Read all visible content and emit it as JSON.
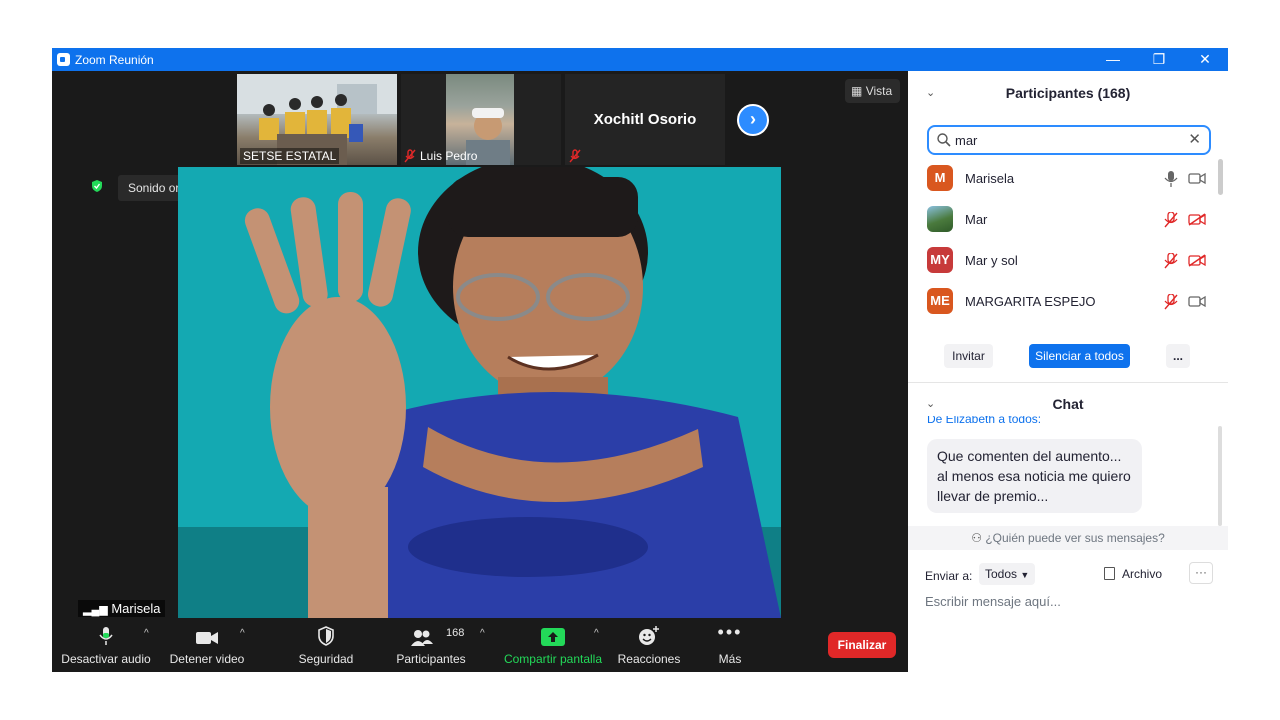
{
  "window": {
    "title": "Zoom Reunión",
    "controls": [
      "—",
      "❐",
      "✕"
    ]
  },
  "stage": {
    "thumbnails": [
      {
        "label": "SETSE ESTATAL"
      },
      {
        "label": "Luis Pedro",
        "muted": true
      },
      {
        "label": "Xochitl Osorio",
        "muted": true
      }
    ],
    "view_button": "Vista",
    "original_sound": "Sonido original: desactivado",
    "speaker_name": "Marisela"
  },
  "toolbar": {
    "audio": "Desactivar audio",
    "video": "Detener video",
    "security": "Seguridad",
    "participants": "Participantes",
    "participants_count": "168",
    "share": "Compartir pantalla",
    "reactions": "Reacciones",
    "more": "Más",
    "end": "Finalizar"
  },
  "panel": {
    "participants_title": "Participantes (168)",
    "search_value": "mar",
    "participants": [
      {
        "initials": "M",
        "name": "Marisela",
        "color": "#d9571f",
        "mic": "on",
        "cam": "on"
      },
      {
        "initials": "",
        "name": "Mar",
        "color": "#4a7a3d",
        "mic": "muted",
        "cam": "off"
      },
      {
        "initials": "MY",
        "name": "Mar y sol",
        "color": "#c73a3a",
        "mic": "muted",
        "cam": "off"
      },
      {
        "initials": "ME",
        "name": "MARGARITA ESPEJO",
        "color": "#d9571f",
        "mic": "muted",
        "cam": "on"
      }
    ],
    "invite": "Invitar",
    "mute_all": "Silenciar a todos",
    "more": "...",
    "chat_title": "Chat",
    "chat_partial": "De Elizabeth a todos:",
    "chat_message": "Que comenten del aumento... al menos esa noticia me quiero llevar de premio...",
    "who_sees": "¿Quién puede ver sus mensajes?",
    "send_to_label": "Enviar a:",
    "send_to_value": "Todos",
    "file_label": "Archivo",
    "message_placeholder": "Escribir mensaje aquí..."
  },
  "colors": {
    "zoom_blue": "#0e72ed",
    "end_red": "#e02828",
    "share_green": "#23d959",
    "muted_red": "#e02828"
  }
}
